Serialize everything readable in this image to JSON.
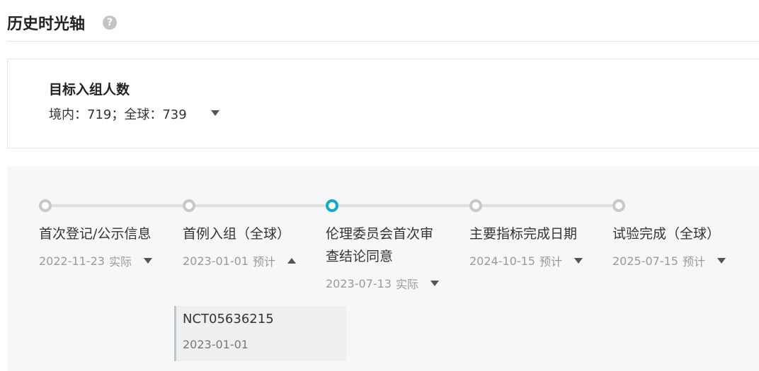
{
  "header": {
    "title": "历史时光轴",
    "help_icon_glyph": "?"
  },
  "target": {
    "title": "目标入组人数",
    "value": "境内：719；全球：739",
    "toggle_icon": "caret-down-icon"
  },
  "timeline": {
    "active_color": "#16a9c5",
    "milestones": [
      {
        "title": "首次登记/公示信息",
        "date": "2022-11-23",
        "status": "实际",
        "expanded": false,
        "active": false
      },
      {
        "title": "首例入组（全球）",
        "date": "2023-01-01",
        "status": "预计",
        "expanded": true,
        "active": false
      },
      {
        "title": "伦理委员会首次审查结论同意",
        "date": "2023-07-13",
        "status": "实际",
        "expanded": false,
        "active": true
      },
      {
        "title": "主要指标完成日期",
        "date": "2024-10-15",
        "status": "预计",
        "expanded": false,
        "active": false
      },
      {
        "title": "试验完成（全球）",
        "date": "2025-07-15",
        "status": "预计",
        "expanded": false,
        "active": false
      }
    ],
    "detail": {
      "id": "NCT05636215",
      "date": "2023-01-01"
    }
  }
}
